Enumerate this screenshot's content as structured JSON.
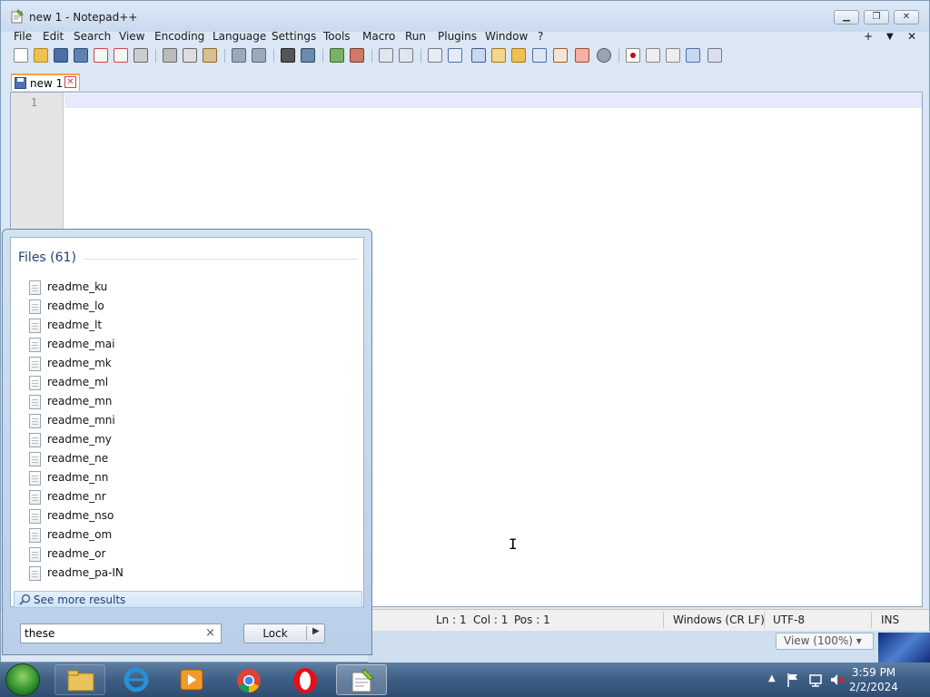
{
  "window": {
    "title": "new 1 - Notepad++",
    "minimize_label": "▁",
    "maximize_label": "❐",
    "close_label": "✕"
  },
  "menu": [
    "File",
    "Edit",
    "Search",
    "View",
    "Encoding",
    "Language",
    "Settings",
    "Tools",
    "Macro",
    "Run",
    "Plugins",
    "Window",
    "?"
  ],
  "menu_right": {
    "plus": "+",
    "down": "▼",
    "close": "✕"
  },
  "tab": {
    "label": "new 1",
    "close": "✕"
  },
  "editor": {
    "line_number": "1"
  },
  "status": {
    "ln": "Ln : 1",
    "col": "Col : 1",
    "pos": "Pos : 1",
    "eol": "Windows (CR LF)",
    "encoding": "UTF-8",
    "mode": "INS"
  },
  "explorer": {
    "view": "View (100%)"
  },
  "start_menu": {
    "files_header": "Files (61)",
    "files": [
      "readme_ku",
      "readme_lo",
      "readme_lt",
      "readme_mai",
      "readme_mk",
      "readme_ml",
      "readme_mn",
      "readme_mni",
      "readme_my",
      "readme_ne",
      "readme_nn",
      "readme_nr",
      "readme_nso",
      "readme_om",
      "readme_or",
      "readme_pa-IN"
    ],
    "see_more": "See more results",
    "search_value": "these",
    "clear": "×",
    "lock": "Lock",
    "lock_arrow": "▶"
  },
  "tray": {
    "time": "3:59 PM",
    "date": "2/2/2024"
  },
  "colors": {
    "accent": "#1e3f7a",
    "current_line": "#e8e8ff",
    "tab_highlight": "#f2a640"
  }
}
